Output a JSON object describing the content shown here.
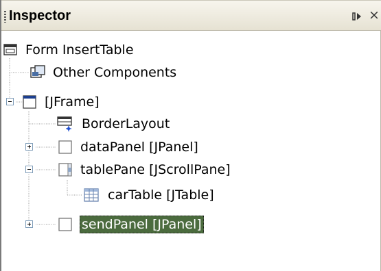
{
  "window": {
    "title": "Inspector",
    "dock_glyph": "▯▸",
    "close_glyph": "×"
  },
  "tree": {
    "nodes": [
      {
        "label": "Form InsertTable",
        "icon": "form-icon",
        "expanded": true
      },
      {
        "label": "Other Components",
        "icon": "components-icon"
      },
      {
        "label": "[JFrame]",
        "icon": "frame-icon",
        "expanded": true
      },
      {
        "label": "BorderLayout",
        "icon": "layout-icon"
      },
      {
        "label": "dataPanel [JPanel]",
        "icon": "panel-icon",
        "expanded": false
      },
      {
        "label": "tablePane [JScrollPane]",
        "icon": "scrollpane-icon",
        "expanded": true
      },
      {
        "label": "carTable [JTable]",
        "icon": "table-icon"
      },
      {
        "label": "sendPanel [JPanel]",
        "icon": "panel-icon",
        "expanded": false,
        "selected": true
      }
    ]
  },
  "colors": {
    "selection_bg": "#4b6b3e",
    "selection_fg": "#ffffff",
    "tree_lines": "#9a9a9a"
  }
}
